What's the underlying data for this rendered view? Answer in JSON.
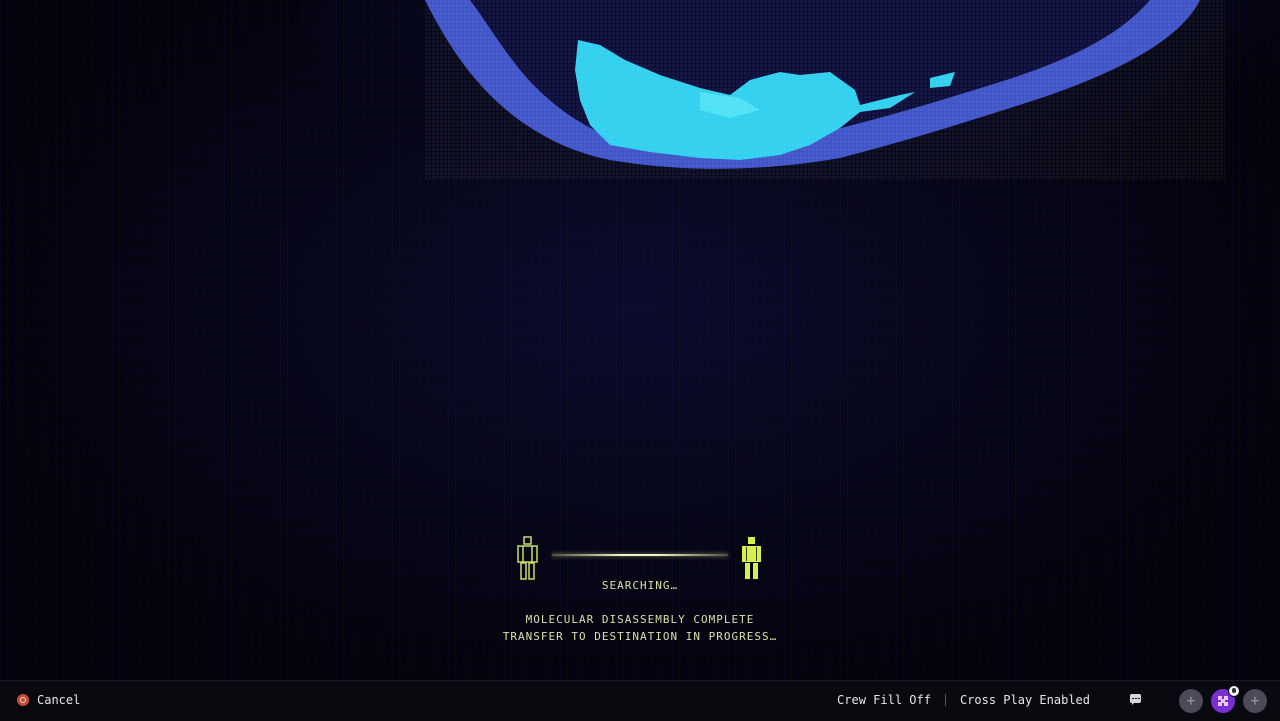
{
  "transfer": {
    "status": "SEARCHING…",
    "message_line1": "MOLECULAR DISASSEMBLY COMPLETE",
    "message_line2": "TRANSFER TO DESTINATION IN PROGRESS…"
  },
  "bottom_bar": {
    "cancel_label": "Cancel",
    "crew_fill": "Crew Fill Off",
    "cross_play": "Cross Play Enabled"
  },
  "colors": {
    "accent_yellow": "#d8f04a",
    "planet_cyan": "#2fd0f0",
    "planet_blue": "#4a62e8",
    "cancel_button": "#c44a3a",
    "avatar": "#7a2fd0"
  },
  "icons": {
    "cancel": "circle-button-icon",
    "chat": "chat-bubble-icon",
    "party_slot": "plus-icon",
    "avatar": "controller-avatar-icon",
    "mic": "microphone-icon"
  }
}
